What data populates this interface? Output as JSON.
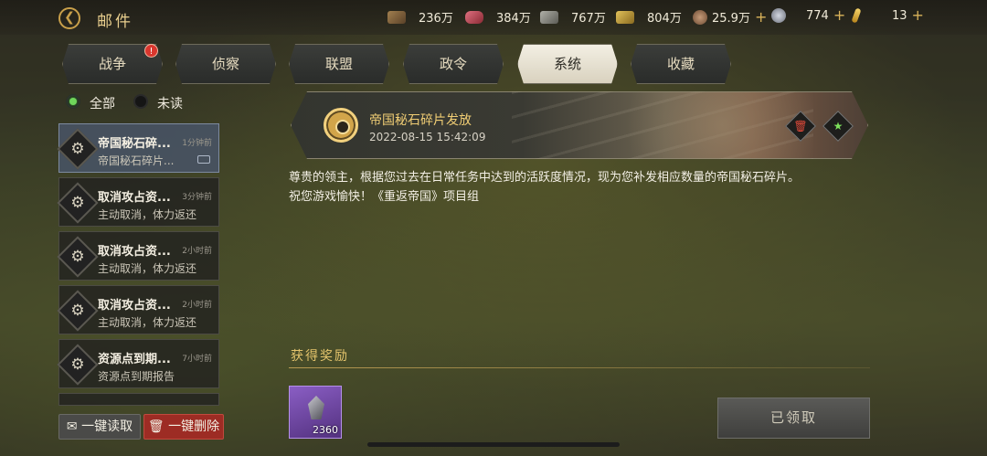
{
  "header": {
    "title": "邮件"
  },
  "resources": [
    {
      "icon": "wood-icon",
      "value": "236万",
      "color": "#8a6a44",
      "has_plus": false
    },
    {
      "icon": "meat-icon",
      "value": "384万",
      "color": "#c8495a",
      "has_plus": false
    },
    {
      "icon": "stone-icon",
      "value": "767万",
      "color": "#8c8c84",
      "has_plus": false
    },
    {
      "icon": "gold-bar-icon",
      "value": "804万",
      "color": "#c9a23c",
      "has_plus": false
    },
    {
      "icon": "coin-icon",
      "value": "25.9万",
      "color": "#b08564",
      "has_plus": true
    },
    {
      "icon": "silver-coin-icon",
      "value": "774",
      "color": "#a9adb8",
      "has_plus": true
    },
    {
      "icon": "gold-stick-icon",
      "value": "13",
      "color": "#e0b03a",
      "has_plus": true
    }
  ],
  "tabs": [
    {
      "label": "战争",
      "badge": "!"
    },
    {
      "label": "侦察"
    },
    {
      "label": "联盟"
    },
    {
      "label": "政令"
    },
    {
      "label": "系统",
      "active": true
    },
    {
      "label": "收藏"
    }
  ],
  "filters": {
    "all": "全部",
    "unread": "未读"
  },
  "mail_list": [
    {
      "title": "帝国秘石碎...",
      "time": "1分钟前",
      "preview": "帝国秘石碎片...",
      "selected": true
    },
    {
      "title": "取消攻占资...",
      "time": "3分钟前",
      "preview": "主动取消，体力返还"
    },
    {
      "title": "取消攻占资...",
      "time": "2小时前",
      "preview": "主动取消，体力返还"
    },
    {
      "title": "取消攻占资...",
      "time": "2小时前",
      "preview": "主动取消，体力返还"
    },
    {
      "title": "资源点到期...",
      "time": "7小时前",
      "preview": "资源点到期报告"
    }
  ],
  "bottom_buttons": {
    "read_all": "一键读取",
    "delete_all": "一键删除"
  },
  "mail_detail": {
    "title": "帝国秘石碎片发放",
    "date": "2022-08-15 15:42:09",
    "body_line1": "尊贵的领主，根据您过去在日常任务中达到的活跃度情况，现为您补发相应数量的帝国秘石碎片。",
    "body_line2": "祝您游戏愉快！《重返帝国》项目组",
    "reward_label": "获得奖励",
    "reward_count": "2360",
    "claimed_label": "已领取"
  }
}
